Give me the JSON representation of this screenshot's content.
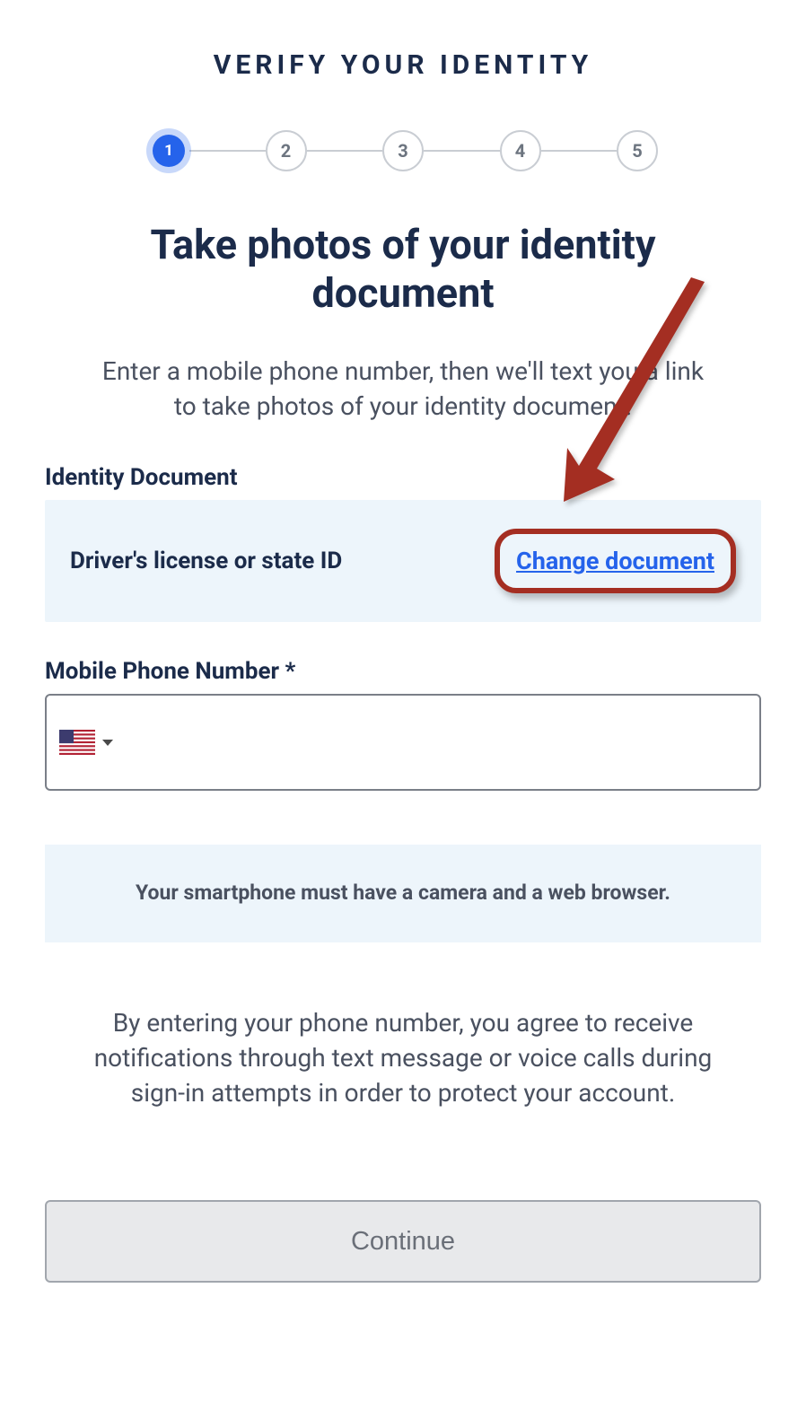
{
  "header": {
    "title": "VERIFY YOUR IDENTITY"
  },
  "stepper": {
    "steps": [
      "1",
      "2",
      "3",
      "4",
      "5"
    ],
    "active": 0
  },
  "main": {
    "heading": "Take photos of your identity document",
    "subheading": "Enter a mobile phone number, then we'll text you a link to take photos of your identity document."
  },
  "document": {
    "label": "Identity Document",
    "value": "Driver's license or state ID",
    "change_link": "Change document"
  },
  "phone": {
    "label": "Mobile Phone Number *",
    "value": "",
    "country": "US"
  },
  "info_box": "Your smartphone must have a camera and a web browser.",
  "disclaimer": "By entering your phone number, you agree to receive notifications through text message or voice calls during sign-in attempts in order to protect your account.",
  "buttons": {
    "continue": "Continue"
  }
}
